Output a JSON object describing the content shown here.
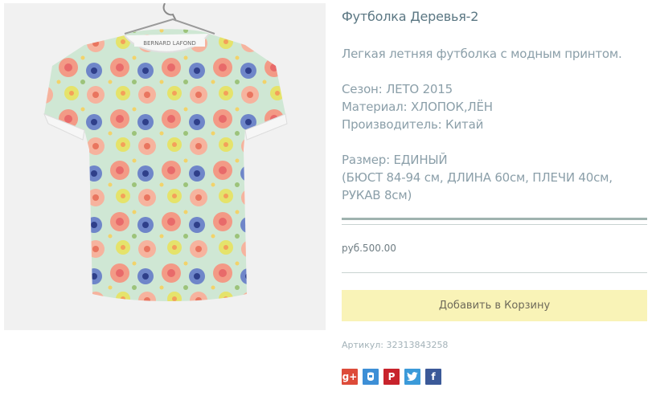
{
  "product": {
    "image_alt": "BERNARD LAFOND",
    "title": "Футболка Деревья-2",
    "description": "Легкая летняя футболка с модным принтом.",
    "season": "Сезон: ЛЕТО 2015",
    "material": "Материал: ХЛОПОК,ЛЁН",
    "manufacturer": "Производитель: Китай",
    "size": "Размер: ЕДИНЫЙ",
    "size_details_1": "(БЮСТ 84-94 см, ДЛИНА 60см, ПЛЕЧИ 40см,",
    "size_details_2": "РУКАВ 8см)",
    "price": "руб.500.00",
    "add_to_cart_label": "Добавить в Корзину",
    "sku": "Артикул: 32313843258"
  },
  "social": [
    {
      "name": "google-plus",
      "glyph": "g+",
      "color": "#dd4b39"
    },
    {
      "name": "odnoklassniki",
      "glyph": "",
      "color": "#3d8fd6"
    },
    {
      "name": "pinterest",
      "glyph": "P",
      "color": "#c8232c"
    },
    {
      "name": "twitter",
      "glyph": "",
      "color": "#3b9ad9"
    },
    {
      "name": "facebook",
      "glyph": "f",
      "color": "#3b5998"
    }
  ]
}
